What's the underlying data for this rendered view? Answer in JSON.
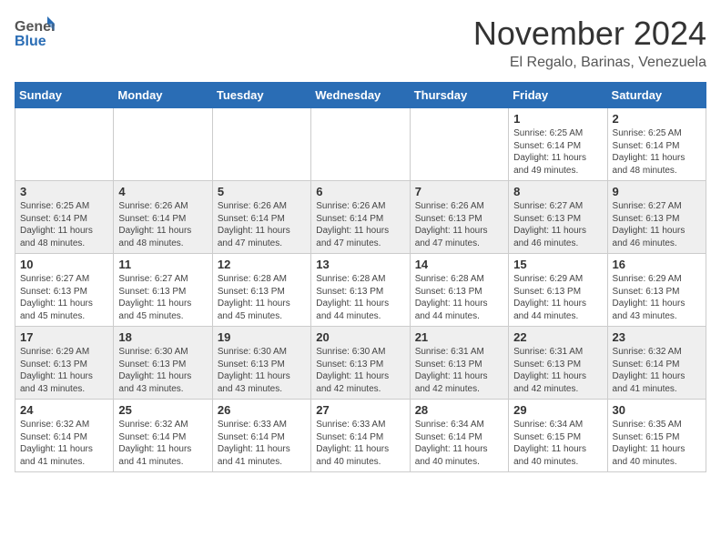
{
  "header": {
    "logo_general": "General",
    "logo_blue": "Blue",
    "month_title": "November 2024",
    "location": "El Regalo, Barinas, Venezuela"
  },
  "days_of_week": [
    "Sunday",
    "Monday",
    "Tuesday",
    "Wednesday",
    "Thursday",
    "Friday",
    "Saturday"
  ],
  "weeks": [
    [
      {
        "day": "",
        "info": ""
      },
      {
        "day": "",
        "info": ""
      },
      {
        "day": "",
        "info": ""
      },
      {
        "day": "",
        "info": ""
      },
      {
        "day": "",
        "info": ""
      },
      {
        "day": "1",
        "info": "Sunrise: 6:25 AM\nSunset: 6:14 PM\nDaylight: 11 hours and 49 minutes."
      },
      {
        "day": "2",
        "info": "Sunrise: 6:25 AM\nSunset: 6:14 PM\nDaylight: 11 hours and 48 minutes."
      }
    ],
    [
      {
        "day": "3",
        "info": "Sunrise: 6:25 AM\nSunset: 6:14 PM\nDaylight: 11 hours and 48 minutes."
      },
      {
        "day": "4",
        "info": "Sunrise: 6:26 AM\nSunset: 6:14 PM\nDaylight: 11 hours and 48 minutes."
      },
      {
        "day": "5",
        "info": "Sunrise: 6:26 AM\nSunset: 6:14 PM\nDaylight: 11 hours and 47 minutes."
      },
      {
        "day": "6",
        "info": "Sunrise: 6:26 AM\nSunset: 6:14 PM\nDaylight: 11 hours and 47 minutes."
      },
      {
        "day": "7",
        "info": "Sunrise: 6:26 AM\nSunset: 6:13 PM\nDaylight: 11 hours and 47 minutes."
      },
      {
        "day": "8",
        "info": "Sunrise: 6:27 AM\nSunset: 6:13 PM\nDaylight: 11 hours and 46 minutes."
      },
      {
        "day": "9",
        "info": "Sunrise: 6:27 AM\nSunset: 6:13 PM\nDaylight: 11 hours and 46 minutes."
      }
    ],
    [
      {
        "day": "10",
        "info": "Sunrise: 6:27 AM\nSunset: 6:13 PM\nDaylight: 11 hours and 45 minutes."
      },
      {
        "day": "11",
        "info": "Sunrise: 6:27 AM\nSunset: 6:13 PM\nDaylight: 11 hours and 45 minutes."
      },
      {
        "day": "12",
        "info": "Sunrise: 6:28 AM\nSunset: 6:13 PM\nDaylight: 11 hours and 45 minutes."
      },
      {
        "day": "13",
        "info": "Sunrise: 6:28 AM\nSunset: 6:13 PM\nDaylight: 11 hours and 44 minutes."
      },
      {
        "day": "14",
        "info": "Sunrise: 6:28 AM\nSunset: 6:13 PM\nDaylight: 11 hours and 44 minutes."
      },
      {
        "day": "15",
        "info": "Sunrise: 6:29 AM\nSunset: 6:13 PM\nDaylight: 11 hours and 44 minutes."
      },
      {
        "day": "16",
        "info": "Sunrise: 6:29 AM\nSunset: 6:13 PM\nDaylight: 11 hours and 43 minutes."
      }
    ],
    [
      {
        "day": "17",
        "info": "Sunrise: 6:29 AM\nSunset: 6:13 PM\nDaylight: 11 hours and 43 minutes."
      },
      {
        "day": "18",
        "info": "Sunrise: 6:30 AM\nSunset: 6:13 PM\nDaylight: 11 hours and 43 minutes."
      },
      {
        "day": "19",
        "info": "Sunrise: 6:30 AM\nSunset: 6:13 PM\nDaylight: 11 hours and 43 minutes."
      },
      {
        "day": "20",
        "info": "Sunrise: 6:30 AM\nSunset: 6:13 PM\nDaylight: 11 hours and 42 minutes."
      },
      {
        "day": "21",
        "info": "Sunrise: 6:31 AM\nSunset: 6:13 PM\nDaylight: 11 hours and 42 minutes."
      },
      {
        "day": "22",
        "info": "Sunrise: 6:31 AM\nSunset: 6:13 PM\nDaylight: 11 hours and 42 minutes."
      },
      {
        "day": "23",
        "info": "Sunrise: 6:32 AM\nSunset: 6:14 PM\nDaylight: 11 hours and 41 minutes."
      }
    ],
    [
      {
        "day": "24",
        "info": "Sunrise: 6:32 AM\nSunset: 6:14 PM\nDaylight: 11 hours and 41 minutes."
      },
      {
        "day": "25",
        "info": "Sunrise: 6:32 AM\nSunset: 6:14 PM\nDaylight: 11 hours and 41 minutes."
      },
      {
        "day": "26",
        "info": "Sunrise: 6:33 AM\nSunset: 6:14 PM\nDaylight: 11 hours and 41 minutes."
      },
      {
        "day": "27",
        "info": "Sunrise: 6:33 AM\nSunset: 6:14 PM\nDaylight: 11 hours and 40 minutes."
      },
      {
        "day": "28",
        "info": "Sunrise: 6:34 AM\nSunset: 6:14 PM\nDaylight: 11 hours and 40 minutes."
      },
      {
        "day": "29",
        "info": "Sunrise: 6:34 AM\nSunset: 6:15 PM\nDaylight: 11 hours and 40 minutes."
      },
      {
        "day": "30",
        "info": "Sunrise: 6:35 AM\nSunset: 6:15 PM\nDaylight: 11 hours and 40 minutes."
      }
    ]
  ]
}
